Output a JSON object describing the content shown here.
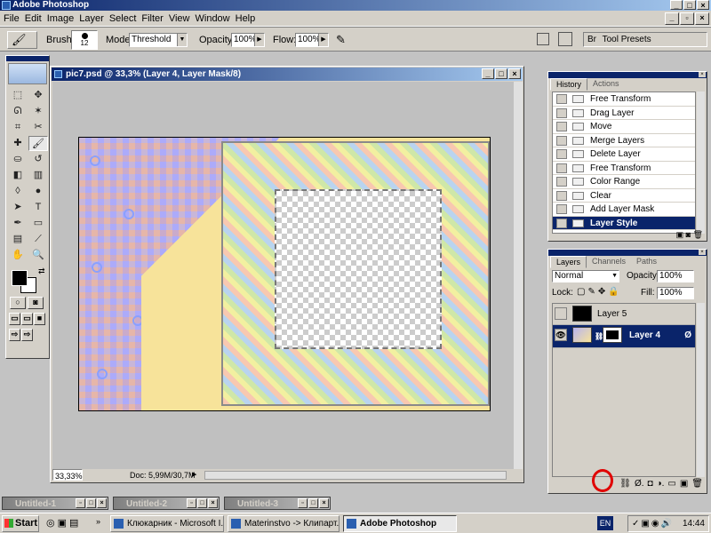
{
  "app": {
    "title": "Adobe Photoshop"
  },
  "menu": [
    "File",
    "Edit",
    "Image",
    "Layer",
    "Select",
    "Filter",
    "View",
    "Window",
    "Help"
  ],
  "options": {
    "brush_label": "Brush:",
    "brush_size": "12",
    "mode_label": "Mode:",
    "mode_value": "Threshold",
    "opacity_label": "Opacity:",
    "opacity_value": "100%",
    "flow_label": "Flow:",
    "flow_value": "100%",
    "tool_presets_label": "Tool Presets",
    "brushes_tab": "Br"
  },
  "document": {
    "title": "pic7.psd @ 33,3% (Layer 4, Layer Mask/8)",
    "zoom": "33,33%",
    "doc_info": "Doc: 5,99M/30,7M"
  },
  "history": {
    "tabs": [
      "History",
      "Actions"
    ],
    "items": [
      "Free Transform",
      "Drag Layer",
      "Move",
      "Merge Layers",
      "Delete Layer",
      "Free Transform",
      "Color Range",
      "Clear",
      "Add Layer Mask",
      "Layer Style"
    ],
    "selected_index": 9
  },
  "layers": {
    "tabs": [
      "Layers",
      "Channels",
      "Paths"
    ],
    "blend_mode": "Normal",
    "opacity_label": "Opacity:",
    "opacity_value": "100%",
    "lock_label": "Lock:",
    "fill_label": "Fill:",
    "fill_value": "100%",
    "items": [
      {
        "name": "Layer 5",
        "selected": false
      },
      {
        "name": "Layer 4",
        "selected": true
      }
    ]
  },
  "minimized_windows": [
    "Untitled-1",
    "Untitled-2",
    "Untitled-3"
  ],
  "taskbar": {
    "start_label": "Start",
    "buttons": [
      "Клюкарник - Microsoft I...",
      "Materinstvo -> Клипарт...",
      "Adobe Photoshop"
    ],
    "active_index": 2,
    "language": "EN",
    "clock": "14:44"
  },
  "colors": {
    "title_bar": "#0a246a",
    "face": "#d4d0c8",
    "highlight_annotation": "#e00000"
  }
}
